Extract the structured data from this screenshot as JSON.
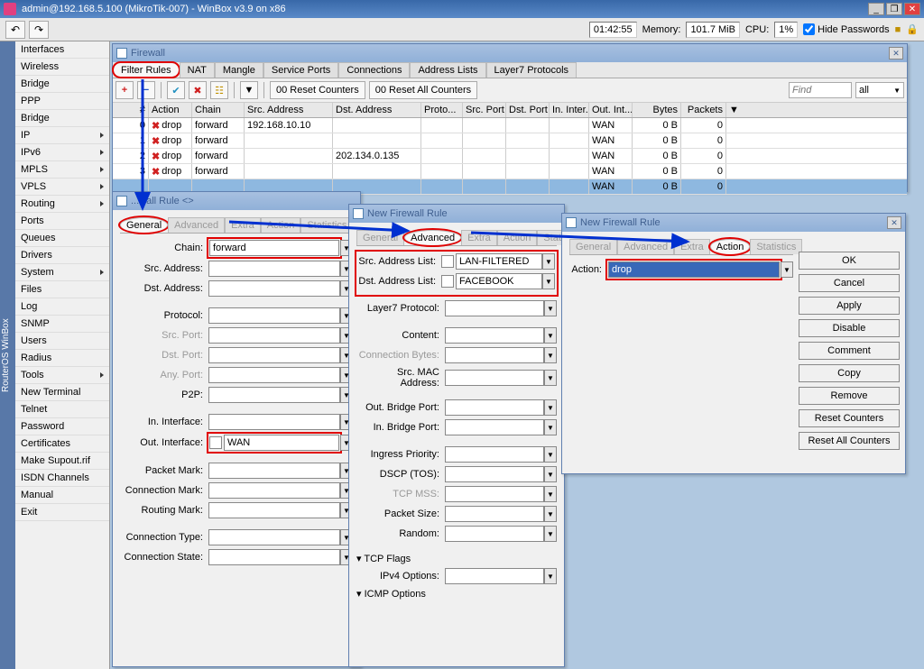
{
  "titlebar": {
    "text": "admin@192.168.5.100 (MikroTik-007) - WinBox v3.9 on x86"
  },
  "main_toolbar": {
    "undo_glyph": "↶",
    "redo_glyph": "↷",
    "time": "01:42:55",
    "memory_label": "Memory:",
    "memory": "101.7 MiB",
    "cpu_label": "CPU:",
    "cpu": "1%",
    "hide_pw": "Hide Passwords"
  },
  "vtab_label": "RouterOS WinBox",
  "sidebar_items": [
    {
      "label": "Interfaces",
      "sub": false
    },
    {
      "label": "Wireless",
      "sub": false
    },
    {
      "label": "Bridge",
      "sub": false
    },
    {
      "label": "PPP",
      "sub": false
    },
    {
      "label": "Bridge",
      "sub": false
    },
    {
      "label": "IP",
      "sub": true
    },
    {
      "label": "IPv6",
      "sub": true
    },
    {
      "label": "MPLS",
      "sub": true
    },
    {
      "label": "VPLS",
      "sub": true
    },
    {
      "label": "Routing",
      "sub": true
    },
    {
      "label": "Ports",
      "sub": false
    },
    {
      "label": "Queues",
      "sub": false
    },
    {
      "label": "Drivers",
      "sub": false
    },
    {
      "label": "System",
      "sub": true
    },
    {
      "label": "Files",
      "sub": false
    },
    {
      "label": "Log",
      "sub": false
    },
    {
      "label": "SNMP",
      "sub": false
    },
    {
      "label": "Users",
      "sub": false
    },
    {
      "label": "Radius",
      "sub": false
    },
    {
      "label": "Tools",
      "sub": true
    },
    {
      "label": "New Terminal",
      "sub": false
    },
    {
      "label": "Telnet",
      "sub": false
    },
    {
      "label": "Password",
      "sub": false
    },
    {
      "label": "Certificates",
      "sub": false
    },
    {
      "label": "Make Supout.rif",
      "sub": false
    },
    {
      "label": "ISDN Channels",
      "sub": false
    },
    {
      "label": "Manual",
      "sub": false
    },
    {
      "label": "Exit",
      "sub": false
    }
  ],
  "firewall_win": {
    "title": "Firewall",
    "tabs": [
      "Filter Rules",
      "NAT",
      "Mangle",
      "Service Ports",
      "Connections",
      "Address Lists",
      "Layer7 Protocols"
    ],
    "active_tab": 0,
    "reset_counters": " 00 Reset Counters",
    "reset_all_counters": " 00 Reset All Counters",
    "find_placeholder": "Find",
    "filter_all": "all",
    "columns": [
      "#",
      "Action",
      "Chain",
      "Src. Address",
      "Dst. Address",
      "Proto...",
      "Src. Port",
      "Dst. Port",
      "In. Inter...",
      "Out. Int...",
      "Bytes",
      "Packets"
    ],
    "rows": [
      {
        "num": "0",
        "action": "drop",
        "chain": "forward",
        "src": "192.168.10.10",
        "dst": "",
        "out": "WAN",
        "bytes": "0 B",
        "pkts": "0"
      },
      {
        "num": "1",
        "action": "drop",
        "chain": "forward",
        "src": "",
        "dst": "",
        "out": "WAN",
        "bytes": "0 B",
        "pkts": "0"
      },
      {
        "num": "2",
        "action": "drop",
        "chain": "forward",
        "src": "",
        "dst": "202.134.0.135",
        "out": "WAN",
        "bytes": "0 B",
        "pkts": "0"
      },
      {
        "num": "3",
        "action": "drop",
        "chain": "forward",
        "src": "",
        "dst": "",
        "out": "WAN",
        "bytes": "0 B",
        "pkts": "0"
      }
    ],
    "footer_out": "WAN",
    "footer_bytes": "0 B",
    "footer_pkts": "0"
  },
  "rule1": {
    "title": "...wall Rule <>",
    "tabs": [
      "General",
      "Advanced",
      "Extra",
      "Action",
      "Statistics"
    ],
    "fields": {
      "chain_label": "Chain:",
      "chain_val": "forward",
      "src_addr_label": "Src. Address:",
      "dst_addr_label": "Dst. Address:",
      "protocol_label": "Protocol:",
      "src_port_label": "Src. Port:",
      "dst_port_label": "Dst. Port:",
      "any_port_label": "Any. Port:",
      "p2p_label": "P2P:",
      "in_if_label": "In. Interface:",
      "out_if_label": "Out. Interface:",
      "out_if_val": "WAN",
      "pkt_mark_label": "Packet Mark:",
      "conn_mark_label": "Connection Mark:",
      "route_mark_label": "Routing Mark:",
      "conn_type_label": "Connection Type:",
      "conn_state_label": "Connection State:"
    }
  },
  "rule2": {
    "title": "New Firewall Rule",
    "tabs": [
      "General",
      "Advanced",
      "Extra",
      "Action",
      "Statisti..."
    ],
    "fields": {
      "src_list_label": "Src. Address List:",
      "src_list_val": "LAN-FILTERED",
      "dst_list_label": "Dst. Address List:",
      "dst_list_val": "FACEBOOK",
      "l7_label": "Layer7 Protocol:",
      "content_label": "Content:",
      "conn_bytes_label": "Connection Bytes:",
      "src_mac_label": "Src. MAC Address:",
      "out_bridge_label": "Out. Bridge Port:",
      "in_bridge_label": "In. Bridge Port:",
      "ingress_label": "Ingress Priority:",
      "dscp_label": "DSCP (TOS):",
      "tcp_mss_label": "TCP MSS:",
      "pkt_size_label": "Packet Size:",
      "random_label": "Random:",
      "tcp_flags_label": "TCP Flags",
      "ipv4_opt_label": "IPv4 Options:",
      "icmp_opt_label": "ICMP Options"
    }
  },
  "rule3": {
    "title": "New Firewall Rule",
    "tabs": [
      "General",
      "Advanced",
      "Extra",
      "Action",
      "Statistics"
    ],
    "action_label": "Action:",
    "action_val": "drop",
    "buttons": [
      "OK",
      "Cancel",
      "Apply",
      "Disable",
      "Comment",
      "Copy",
      "Remove",
      "Reset Counters",
      "Reset All Counters"
    ]
  }
}
